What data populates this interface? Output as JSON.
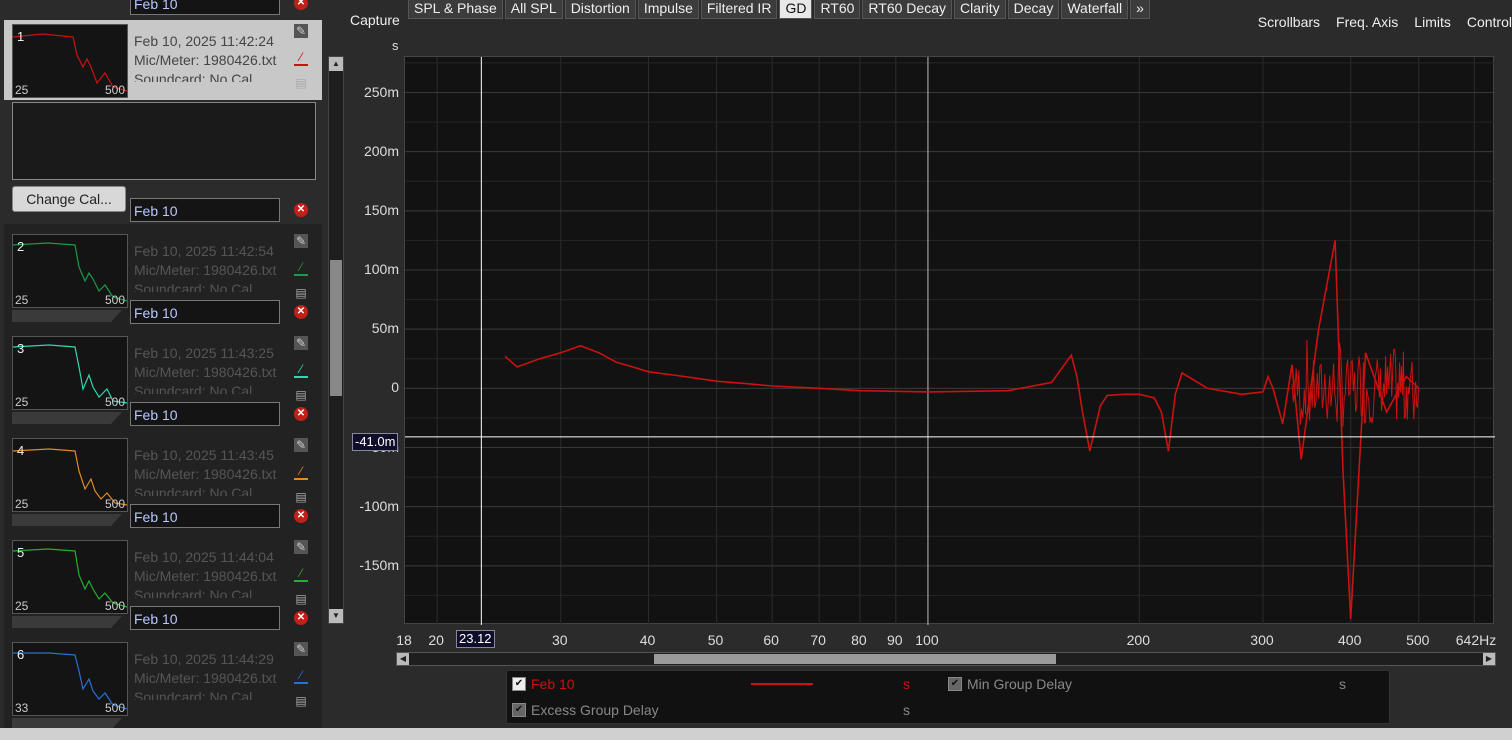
{
  "toolbar": {
    "capture_label": "Capture",
    "tabs": [
      {
        "label": "SPL & Phase"
      },
      {
        "label": "All SPL"
      },
      {
        "label": "Distortion"
      },
      {
        "label": "Impulse"
      },
      {
        "label": "Filtered IR"
      },
      {
        "label": "GD"
      },
      {
        "label": "RT60"
      },
      {
        "label": "RT60 Decay"
      },
      {
        "label": "Clarity"
      },
      {
        "label": "Decay"
      },
      {
        "label": "Waterfall"
      },
      {
        "label": "»"
      }
    ],
    "active_tab": "GD",
    "right_tools": [
      {
        "label": "Scrollbars"
      },
      {
        "label": "Freq. Axis"
      },
      {
        "label": "Limits"
      },
      {
        "label": "Control"
      }
    ]
  },
  "measurements": [
    {
      "num": "1",
      "name": "Feb 10",
      "datetime": "Feb 10, 2025 11:42:24",
      "mic": "Mic/Meter: 1980426.txt",
      "soundcard": "Soundcard: No Cal",
      "lo": "25",
      "hi": "500",
      "color": "#cc1111",
      "selected": true
    },
    {
      "num": "2",
      "name": "Feb 10",
      "datetime": "Feb 10, 2025 11:42:54",
      "mic": "Mic/Meter: 1980426.txt",
      "soundcard": "Soundcard: No Cal",
      "lo": "25",
      "hi": "500",
      "color": "#1a9a4a",
      "selected": false
    },
    {
      "num": "3",
      "name": "Feb 10",
      "datetime": "Feb 10, 2025 11:43:25",
      "mic": "Mic/Meter: 1980426.txt",
      "soundcard": "Soundcard: No Cal",
      "lo": "25",
      "hi": "500",
      "color": "#2ed8b0",
      "selected": false
    },
    {
      "num": "4",
      "name": "Feb 10",
      "datetime": "Feb 10, 2025 11:43:45",
      "mic": "Mic/Meter: 1980426.txt",
      "soundcard": "Soundcard: No Cal",
      "lo": "25",
      "hi": "500",
      "color": "#e08a20",
      "selected": false
    },
    {
      "num": "5",
      "name": "Feb 10",
      "datetime": "Feb 10, 2025 11:44:04",
      "mic": "Mic/Meter: 1980426.txt",
      "soundcard": "Soundcard: No Cal",
      "lo": "25",
      "hi": "500",
      "color": "#22b030",
      "selected": false
    },
    {
      "num": "6",
      "name": "Feb 10",
      "datetime": "Feb 10, 2025 11:44:29",
      "mic": "Mic/Meter: 1980426.txt",
      "soundcard": "Soundcard: No Cal",
      "lo": "33",
      "hi": "500",
      "color": "#2a70d8",
      "selected": false
    }
  ],
  "change_cal_label": "Change Cal...",
  "icons": {
    "close": "close-icon",
    "edit": "edit-pencil-icon",
    "line_style": "line-color-icon",
    "notes": "notes-icon"
  },
  "plot": {
    "unit": "s",
    "y_ticks": [
      "250m",
      "200m",
      "150m",
      "100m",
      "50m",
      "0",
      "-50m",
      "-100m",
      "-150m"
    ],
    "x_ticks": [
      "18",
      "20",
      "30",
      "40",
      "50",
      "60",
      "70",
      "80",
      "90",
      "100",
      "200",
      "300",
      "400",
      "500",
      "642Hz"
    ],
    "cursor_x": "23.12",
    "cursor_y": "-41.0m",
    "trace_color": "#cc1111"
  },
  "chart_data": {
    "type": "line",
    "title": "",
    "xlabel": "Hz",
    "ylabel": "s",
    "x_scale": "log",
    "xlim": [
      18,
      642
    ],
    "ylim": [
      -0.2,
      0.28
    ],
    "grid": true,
    "series": [
      {
        "name": "Feb 10",
        "color": "#cc1111",
        "x": [
          25,
          26,
          28,
          30,
          32,
          34,
          36,
          38,
          40,
          45,
          50,
          55,
          60,
          70,
          80,
          100,
          130,
          150,
          160,
          163,
          166,
          170,
          176,
          180,
          190,
          200,
          210,
          215,
          220,
          225,
          230,
          250,
          280,
          300,
          305,
          310,
          320,
          330,
          340,
          360,
          380,
          390,
          400,
          420,
          450,
          480,
          500
        ],
        "y": [
          0.027,
          0.018,
          0.025,
          0.03,
          0.036,
          0.03,
          0.022,
          0.018,
          0.014,
          0.01,
          0.006,
          0.004,
          0.002,
          0.0,
          -0.002,
          -0.003,
          -0.002,
          0.005,
          0.028,
          0.01,
          -0.02,
          -0.053,
          -0.015,
          -0.006,
          -0.005,
          -0.005,
          -0.008,
          -0.02,
          -0.053,
          -0.005,
          0.013,
          0.0,
          -0.005,
          -0.003,
          0.01,
          0.0,
          -0.03,
          0.02,
          -0.06,
          0.05,
          0.125,
          -0.07,
          -0.195,
          0.03,
          -0.02,
          0.01,
          0.0
        ]
      }
    ]
  },
  "legend": {
    "row1_name": "Feb 10",
    "row1_unit": "s",
    "row1_right": "Min Group Delay",
    "row1_right_unit": "s",
    "row2_name": "Excess Group Delay",
    "row2_unit": "s"
  }
}
